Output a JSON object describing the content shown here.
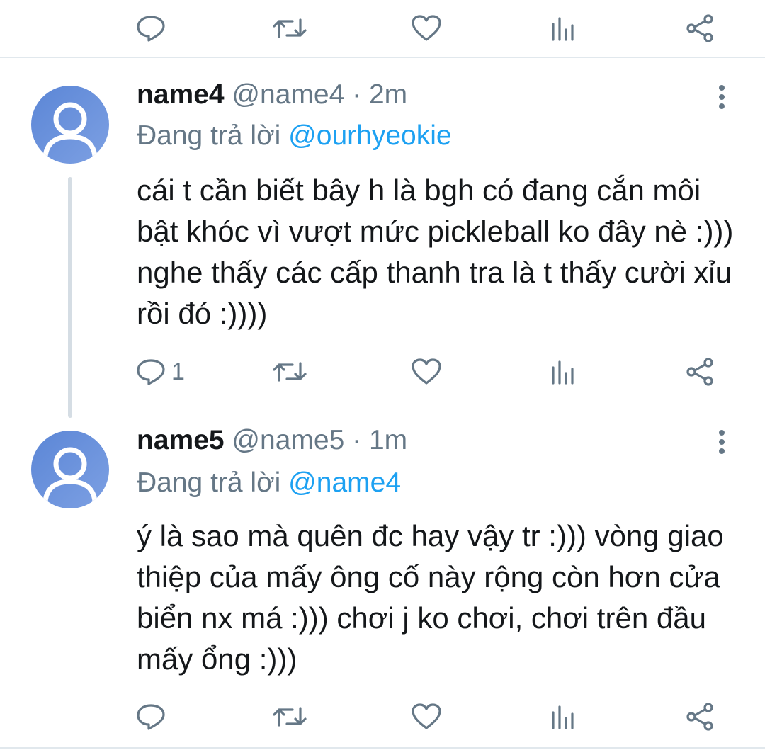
{
  "tweets": [
    {
      "display_name": "name4",
      "handle": "@name4",
      "separator": "·",
      "time": "2m",
      "reply_prefix": "Đang trả lời",
      "reply_to": "@ourhyeokie",
      "text": "cái t cần biết bây h là bgh có đang cắn môi bật khóc vì vượt mức pickleball ko đây nè :))) nghe thấy các cấp thanh tra là t thấy cười xỉu rồi đó :))))",
      "reply_count": "1"
    },
    {
      "display_name": "name5",
      "handle": "@name5",
      "separator": "·",
      "time": "1m",
      "reply_prefix": "Đang trả lời",
      "reply_to": "@name4",
      "text": "ý là sao mà quên đc hay vậy tr :))) vòng giao thiệp của mấy ông cố này rộng còn hơn cửa biển nx má :))) chơi j ko chơi, chơi trên đầu mấy ổng :)))",
      "reply_count": ""
    }
  ],
  "icons": {
    "reply": "reply-icon",
    "retweet": "retweet-icon",
    "like": "like-icon",
    "analytics": "analytics-icon",
    "share": "share-icon",
    "more": "more-icon",
    "avatar": "default-avatar"
  },
  "colors": {
    "mention": "#1da1f2",
    "secondary": "#657786",
    "divider": "#e1e8ed"
  }
}
